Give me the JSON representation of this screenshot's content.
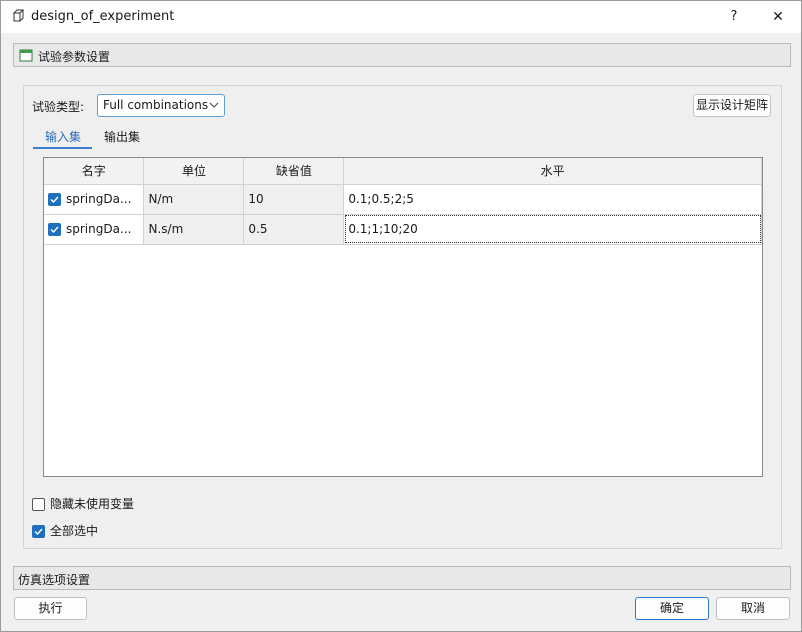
{
  "window": {
    "title": "design_of_experiment",
    "help_label": "?",
    "close_label": "✕"
  },
  "sections": {
    "params_title": "试验参数设置",
    "sim_title": "仿真选项设置"
  },
  "experiment": {
    "type_label": "试验类型:",
    "type_value": "Full combinations",
    "show_matrix_label": "显示设计矩阵"
  },
  "tabs": [
    {
      "label": "输入集",
      "active": true
    },
    {
      "label": "输出集",
      "active": false
    }
  ],
  "table": {
    "columns": [
      "名字",
      "单位",
      "缺省值",
      "水平"
    ],
    "rows": [
      {
        "checked": true,
        "name": "springDa...",
        "unit": "N/m",
        "default": "10",
        "levels": "0.1;0.5;2;5"
      },
      {
        "checked": true,
        "name": "springDa...",
        "unit": "N.s/m",
        "default": "0.5",
        "levels": "0.1;1;10;20"
      }
    ]
  },
  "options": {
    "hide_unused_label": "隐藏未使用变量",
    "hide_unused_checked": false,
    "select_all_label": "全部选中",
    "select_all_checked": true
  },
  "buttons": {
    "run": "执行",
    "ok": "确定",
    "cancel": "取消"
  },
  "colors": {
    "accent": "#1f6fbf",
    "tab_active": "#2c6ebf"
  }
}
